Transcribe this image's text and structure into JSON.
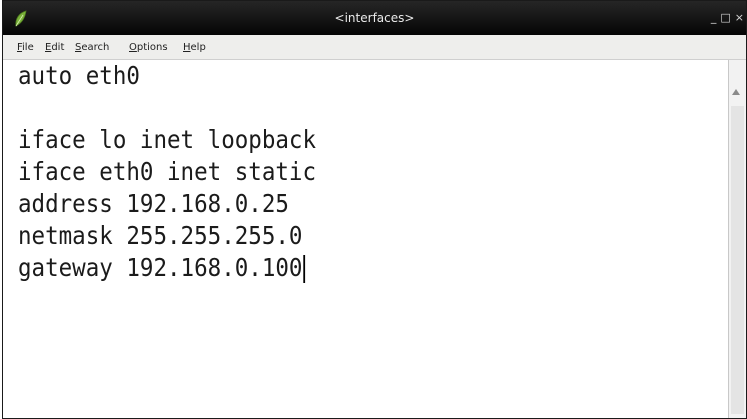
{
  "window": {
    "title": "<interfaces>",
    "controls": {
      "minimize": "_",
      "maximize": "□",
      "close": "×"
    }
  },
  "menu": {
    "file": {
      "mnemonic": "F",
      "rest": "ile"
    },
    "edit": {
      "mnemonic": "E",
      "rest": "dit"
    },
    "search": {
      "mnemonic": "S",
      "rest": "earch"
    },
    "options": {
      "mnemonic": "O",
      "rest": "ptions"
    },
    "help": {
      "mnemonic": "H",
      "rest": "elp"
    }
  },
  "editor": {
    "lines": [
      "auto eth0",
      "",
      "iface lo inet loopback",
      "iface eth0 inet static",
      "address 192.168.0.25",
      "netmask 255.255.255.0",
      "gateway 192.168.0.100"
    ]
  },
  "icons": {
    "app": "leafpad-icon",
    "scroll_up": "scroll-up-arrow-icon"
  },
  "colors": {
    "titlebar": "#0b0b0b",
    "menubar": "#eeeeec",
    "app_icon_green": "#7ab13a"
  }
}
